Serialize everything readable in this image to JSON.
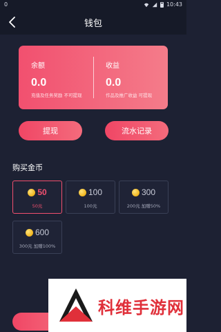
{
  "status": {
    "left": "0",
    "time": "10:43"
  },
  "nav": {
    "title": "钱包"
  },
  "wallet": {
    "balance": {
      "label": "余额",
      "value": "0.0",
      "note": "充值及任务奖励 不可提现"
    },
    "income": {
      "label": "收益",
      "value": "0.0",
      "note": "作品及推广收益 可提现"
    }
  },
  "buttons": {
    "withdraw": "提现",
    "records": "流水记录"
  },
  "purchase": {
    "title": "购买金币",
    "options": [
      {
        "amount": "50",
        "price": "50元",
        "selected": true
      },
      {
        "amount": "100",
        "price": "100元",
        "selected": false
      },
      {
        "amount": "300",
        "price": "200元 加赠50%",
        "selected": false
      },
      {
        "amount": "600",
        "price": "300元 加赠100%",
        "selected": false
      }
    ]
  },
  "watermark": {
    "text": "科维手游网"
  },
  "colors": {
    "accent": "#f2506f",
    "background": "#1d2133",
    "coin": "#f0b41c"
  }
}
